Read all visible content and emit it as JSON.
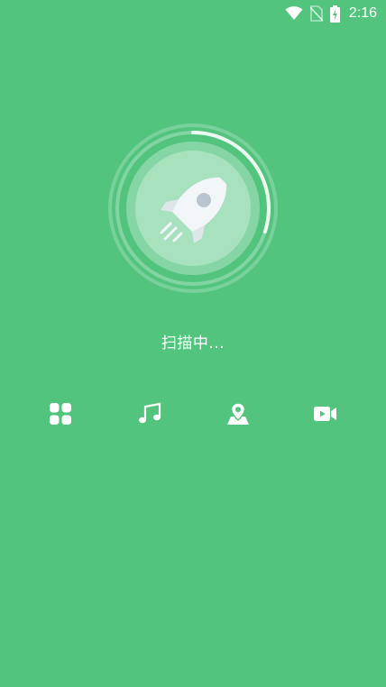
{
  "status_bar": {
    "time": "2:16",
    "icons": [
      "wifi-icon",
      "no-sim-icon",
      "battery-charging-icon"
    ]
  },
  "scan": {
    "status_text": "扫描中...",
    "icon": "rocket-icon",
    "progress": 0.3
  },
  "categories": [
    {
      "icon": "apps-grid-icon"
    },
    {
      "icon": "music-note-icon"
    },
    {
      "icon": "map-location-icon"
    },
    {
      "icon": "video-camera-icon"
    }
  ],
  "colors": {
    "background": "#52c47e",
    "foreground": "#ffffff"
  }
}
